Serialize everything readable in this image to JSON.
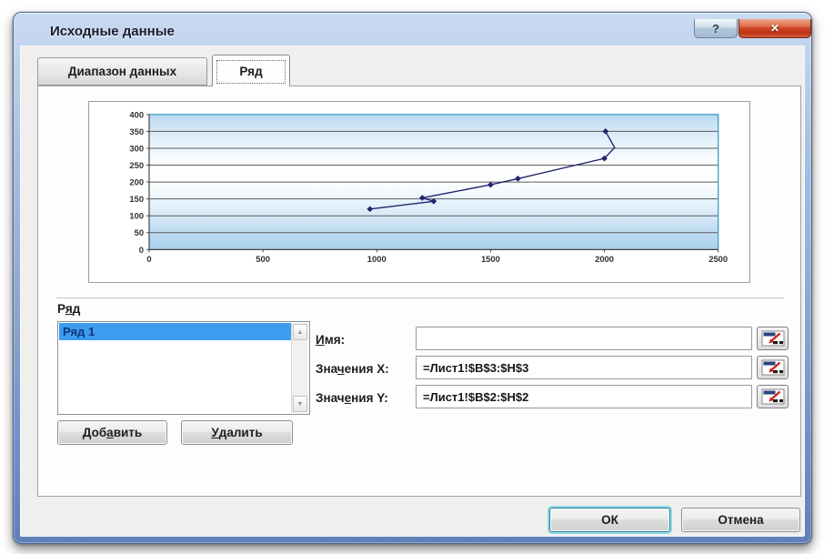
{
  "window": {
    "title": "Исходные данные",
    "help_button": "?",
    "close_button": "✕"
  },
  "tabs": {
    "items": [
      {
        "label": "Диапазон данных",
        "active": false
      },
      {
        "label": "Ряд",
        "active": true
      }
    ]
  },
  "chart_data": {
    "type": "line",
    "title": "",
    "xlabel": "",
    "ylabel": "",
    "xlim": [
      0,
      2500
    ],
    "ylim": [
      0,
      400
    ],
    "x_ticks": [
      0,
      500,
      1000,
      1500,
      2000,
      2500
    ],
    "y_ticks": [
      0,
      50,
      100,
      150,
      200,
      250,
      300,
      350,
      400
    ],
    "gridlines": "horizontal",
    "legend": "none",
    "plot_background": "blue-gradient",
    "series": [
      {
        "name": "Ряд 1",
        "x": [
          970,
          1250,
          1200,
          1500,
          1620,
          2000,
          2005
        ],
        "y": [
          120,
          143,
          153,
          192,
          210,
          270,
          350
        ],
        "marker": "diamond",
        "color": "#23246e"
      }
    ],
    "line_bend": {
      "after_index": 5,
      "x": 2045,
      "y": 302
    }
  },
  "series_panel": {
    "group_label": "Ряд",
    "group_label_underline": 1,
    "list": {
      "items": [
        {
          "label": "Ряд 1",
          "selected": true
        }
      ]
    },
    "buttons": {
      "add": {
        "label": "Добавить",
        "underline": 3
      },
      "remove": {
        "label": "Удалить",
        "underline": 0
      }
    },
    "fields": [
      {
        "label": "Имя:",
        "underline": 0,
        "value": ""
      },
      {
        "label": "Значения X:",
        "underline": 3,
        "value": "=Лист1!$B$3:$H$3"
      },
      {
        "label": "Значения Y:",
        "underline": 4,
        "value": "=Лист1!$B$2:$H$2"
      }
    ]
  },
  "footer": {
    "ok_label": "ОК",
    "cancel_label": "Отмена"
  },
  "icons": {
    "scroll_up": "▲",
    "scroll_down": "▼"
  },
  "colors": {
    "frame_blue": "#7c9bcd",
    "selection_bg": "#3d9bf0",
    "selection_text": "#0d3579",
    "chart_line": "#23246e",
    "close_button_red": "#c43a23",
    "ok_focus_ring": "#8fd9e6"
  }
}
